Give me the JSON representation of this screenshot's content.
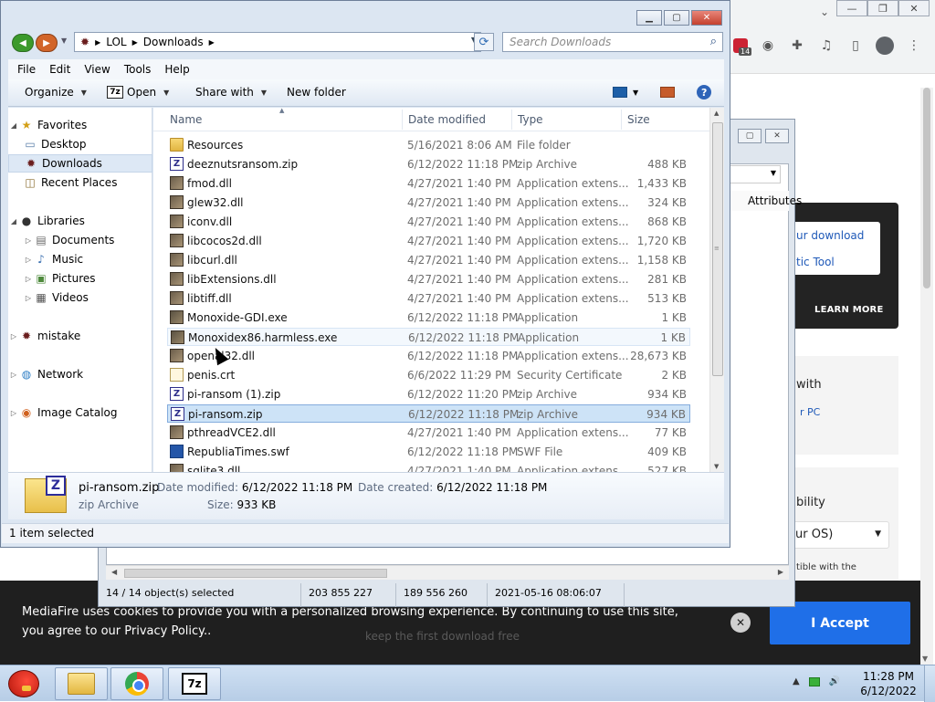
{
  "browser": {
    "extension_badge": "14",
    "window_controls": [
      "—",
      "❐",
      "✕"
    ],
    "download_links": [
      "ur download",
      "tic Tool"
    ],
    "learn_more": "LEARN MORE",
    "card1_text": "with",
    "card1_link": "r PC",
    "card2_text": "bility",
    "os_select": "ur OS)",
    "card2_note": "tible with the"
  },
  "cookie": {
    "text": "MediaFire uses cookies to provide you with a personalized browsing experience. By continuing to use this site, you agree to our Privacy Policy..",
    "accept": "I Accept",
    "close": "✕",
    "ghost_text": "keep the first download free"
  },
  "zip_window": {
    "column_attributes": "Attributes",
    "status": {
      "selected": "14 / 14 object(s) selected",
      "size": "203 855 227",
      "packed": "189 556 260",
      "modified": "2021-05-16 08:06:07"
    }
  },
  "explorer": {
    "breadcrumb": [
      "LOL",
      "Downloads"
    ],
    "search_placeholder": "Search Downloads",
    "menu": [
      "File",
      "Edit",
      "View",
      "Tools",
      "Help"
    ],
    "toolbar": {
      "organize": "Organize",
      "open": "Open",
      "share": "Share with",
      "new_folder": "New folder"
    },
    "nav": [
      {
        "label": "Favorites",
        "level": 0
      },
      {
        "label": "Desktop",
        "level": 1
      },
      {
        "label": "Downloads",
        "level": 1
      },
      {
        "label": "Recent Places",
        "level": 1
      },
      {
        "label": "Libraries",
        "level": 0
      },
      {
        "label": "Documents",
        "level": 1
      },
      {
        "label": "Music",
        "level": 1
      },
      {
        "label": "Pictures",
        "level": 1
      },
      {
        "label": "Videos",
        "level": 1
      },
      {
        "label": "mistake",
        "level": 0
      },
      {
        "label": "Network",
        "level": 0
      },
      {
        "label": "Image Catalog",
        "level": 0
      }
    ],
    "columns": {
      "name": "Name",
      "date": "Date modified",
      "type": "Type",
      "size": "Size"
    },
    "files": [
      {
        "name": "Resources",
        "date": "5/16/2021 8:06 AM",
        "type": "File folder",
        "size": "",
        "icon": "folder"
      },
      {
        "name": "deeznutsransom.zip",
        "date": "6/12/2022 11:18 PM",
        "type": "zip Archive",
        "size": "488 KB",
        "icon": "zip"
      },
      {
        "name": "fmod.dll",
        "date": "4/27/2021 1:40 PM",
        "type": "Application extens...",
        "size": "1,433 KB",
        "icon": "dll"
      },
      {
        "name": "glew32.dll",
        "date": "4/27/2021 1:40 PM",
        "type": "Application extens...",
        "size": "324 KB",
        "icon": "dll"
      },
      {
        "name": "iconv.dll",
        "date": "4/27/2021 1:40 PM",
        "type": "Application extens...",
        "size": "868 KB",
        "icon": "dll"
      },
      {
        "name": "libcocos2d.dll",
        "date": "4/27/2021 1:40 PM",
        "type": "Application extens...",
        "size": "1,720 KB",
        "icon": "dll"
      },
      {
        "name": "libcurl.dll",
        "date": "4/27/2021 1:40 PM",
        "type": "Application extens...",
        "size": "1,158 KB",
        "icon": "dll"
      },
      {
        "name": "libExtensions.dll",
        "date": "4/27/2021 1:40 PM",
        "type": "Application extens...",
        "size": "281 KB",
        "icon": "dll"
      },
      {
        "name": "libtiff.dll",
        "date": "4/27/2021 1:40 PM",
        "type": "Application extens...",
        "size": "513 KB",
        "icon": "dll"
      },
      {
        "name": "Monoxide-GDI.exe",
        "date": "6/12/2022 11:18 PM",
        "type": "Application",
        "size": "1 KB",
        "icon": "exe"
      },
      {
        "name": "Monoxidex86.harmless.exe",
        "date": "6/12/2022 11:18 PM",
        "type": "Application",
        "size": "1 KB",
        "icon": "exe"
      },
      {
        "name": "openal32.dll",
        "date": "6/12/2022 11:18 PM",
        "type": "Application extens...",
        "size": "28,673 KB",
        "icon": "dll"
      },
      {
        "name": "penis.crt",
        "date": "6/6/2022 11:29 PM",
        "type": "Security Certificate",
        "size": "2 KB",
        "icon": "crt"
      },
      {
        "name": "pi-ransom (1).zip",
        "date": "6/12/2022 11:20 PM",
        "type": "zip Archive",
        "size": "934 KB",
        "icon": "zip"
      },
      {
        "name": "pi-ransom.zip",
        "date": "6/12/2022 11:18 PM",
        "type": "zip Archive",
        "size": "934 KB",
        "icon": "zip"
      },
      {
        "name": "pthreadVCE2.dll",
        "date": "4/27/2021 1:40 PM",
        "type": "Application extens...",
        "size": "77 KB",
        "icon": "dll"
      },
      {
        "name": "RepubliaTimes.swf",
        "date": "6/12/2022 11:18 PM",
        "type": "SWF File",
        "size": "409 KB",
        "icon": "swf"
      },
      {
        "name": "sqlite3.dll",
        "date": "4/27/2021 1:40 PM",
        "type": "Application extens...",
        "size": "527 KB",
        "icon": "dll"
      }
    ],
    "selected_index": 14,
    "hover_index": 10,
    "details": {
      "filename": "pi-ransom.zip",
      "filetype": "zip Archive",
      "date_modified_label": "Date modified:",
      "date_modified": "6/12/2022 11:18 PM",
      "date_created_label": "Date created:",
      "date_created": "6/12/2022 11:18 PM",
      "size_label": "Size:",
      "size": "933 KB"
    },
    "status": "1 item selected"
  },
  "taskbar": {
    "time": "11:28 PM",
    "date": "6/12/2022",
    "sevenzip_label": "7z"
  }
}
